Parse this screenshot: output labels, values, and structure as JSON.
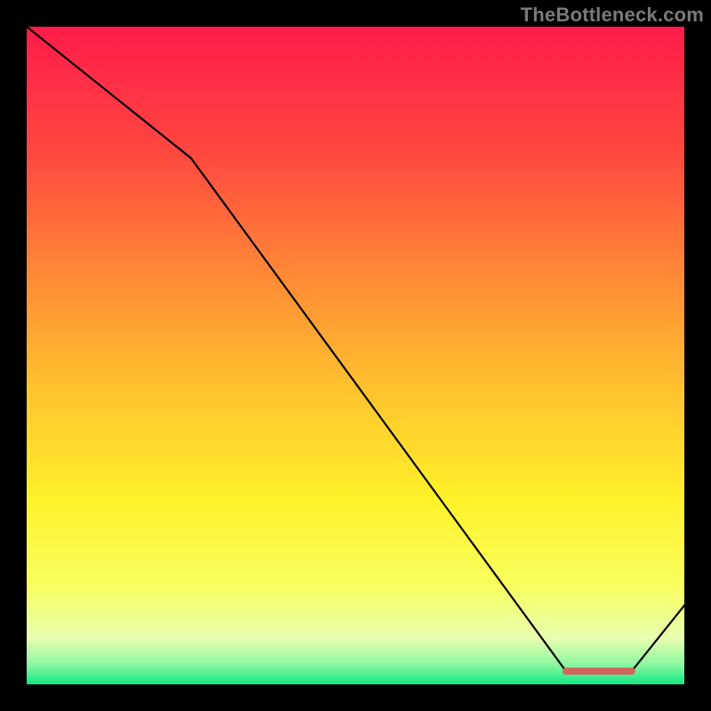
{
  "attribution": "TheBottleneck.com",
  "chart_data": {
    "type": "line",
    "title": "",
    "xlabel": "",
    "ylabel": "",
    "xlim": [
      0,
      100
    ],
    "ylim": [
      0,
      100
    ],
    "x": [
      0,
      25,
      82,
      92,
      100
    ],
    "values": [
      100,
      80,
      2,
      2,
      12
    ],
    "flat_segment": {
      "x": [
        82,
        92
      ],
      "y": 2,
      "color": "#d4645e",
      "stroke_width": 8
    },
    "gradient_stops": [
      {
        "offset": 0.0,
        "color": "#ff1b4a"
      },
      {
        "offset": 0.2,
        "color": "#ff4a3f"
      },
      {
        "offset": 0.38,
        "color": "#ff8a36"
      },
      {
        "offset": 0.55,
        "color": "#ffc22e"
      },
      {
        "offset": 0.72,
        "color": "#fff22a"
      },
      {
        "offset": 0.85,
        "color": "#f8ff60"
      },
      {
        "offset": 0.93,
        "color": "#e8ffb0"
      },
      {
        "offset": 0.97,
        "color": "#8cf7a0"
      },
      {
        "offset": 1.0,
        "color": "#10e884"
      }
    ]
  }
}
